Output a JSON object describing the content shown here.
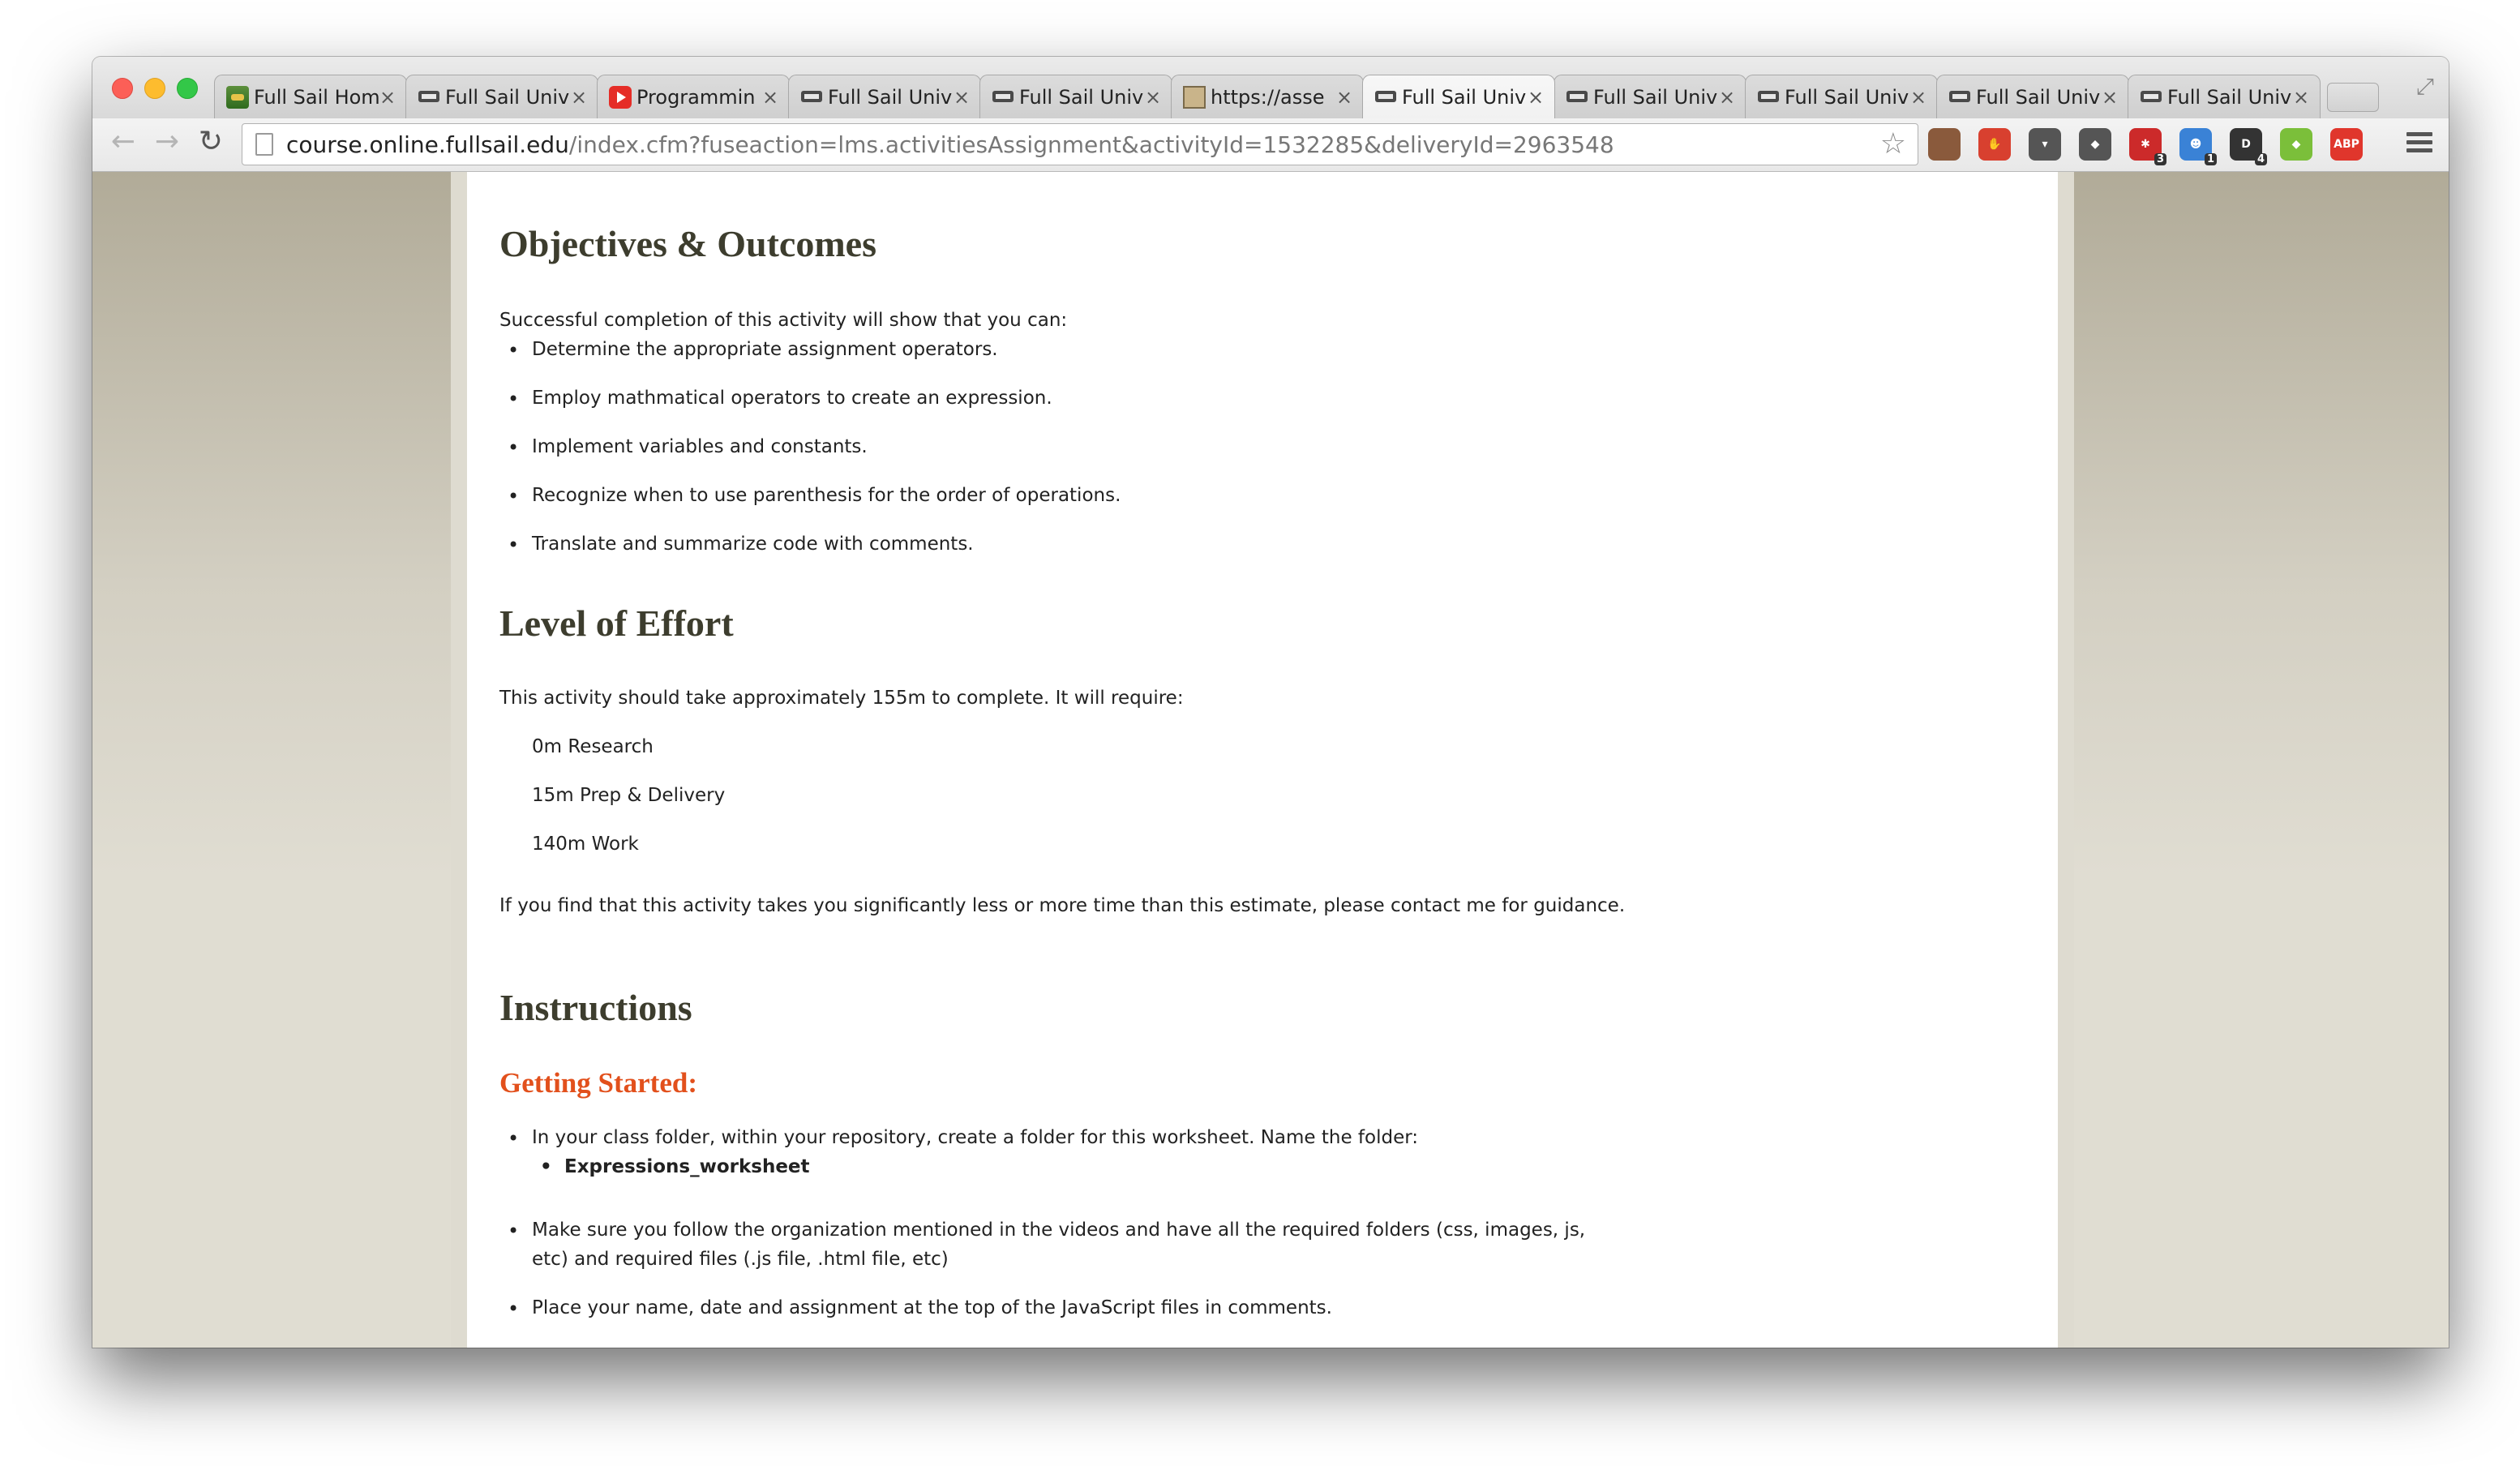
{
  "browser": {
    "tabs": [
      {
        "title": "Full Sail Hom",
        "favicon": "hat-icon",
        "active": false
      },
      {
        "title": "Full Sail Univ",
        "favicon": "fullsail-icon",
        "active": false
      },
      {
        "title": "Programmin",
        "favicon": "youtube-icon",
        "active": false
      },
      {
        "title": "Full Sail Univ",
        "favicon": "fullsail-icon",
        "active": false
      },
      {
        "title": "Full Sail Univ",
        "favicon": "fullsail-icon",
        "active": false
      },
      {
        "title": "https://asse",
        "favicon": "image-icon",
        "active": false
      },
      {
        "title": "Full Sail Univ",
        "favicon": "fullsail-icon",
        "active": true
      },
      {
        "title": "Full Sail Univ",
        "favicon": "fullsail-icon",
        "active": false
      },
      {
        "title": "Full Sail Univ",
        "favicon": "fullsail-icon",
        "active": false
      },
      {
        "title": "Full Sail Univ",
        "favicon": "fullsail-icon",
        "active": false
      },
      {
        "title": "Full Sail Univ",
        "favicon": "fullsail-icon",
        "active": false
      }
    ],
    "tab_close": "×",
    "url_host": "course.online.fullsail.edu",
    "url_path": "/index.cfm?fuseaction=lms.activitiesAssignment&activityId=1532285&deliveryId=2963548",
    "extensions": [
      {
        "name": "instagram-extension-icon",
        "color": "#8a5a3c",
        "label": "",
        "badge": ""
      },
      {
        "name": "stop-hand-extension-icon",
        "color": "#d8402f",
        "label": "✋",
        "badge": ""
      },
      {
        "name": "pocket-extension-icon",
        "color": "#555555",
        "label": "▾",
        "badge": ""
      },
      {
        "name": "tag-extension-icon",
        "color": "#555555",
        "label": "◆",
        "badge": ""
      },
      {
        "name": "puzzle-red-extension-icon",
        "color": "#cc2a2a",
        "label": "✱",
        "badge": "3"
      },
      {
        "name": "ghost-extension-icon",
        "color": "#3a82d6",
        "label": "☻",
        "badge": "1"
      },
      {
        "name": "d-extension-icon",
        "color": "#333333",
        "label": "D",
        "badge": "4"
      },
      {
        "name": "leaf-extension-icon",
        "color": "#7bbf3a",
        "label": "◆",
        "badge": ""
      },
      {
        "name": "adblock-extension-icon",
        "color": "#e0362c",
        "label": "ABP",
        "badge": ""
      }
    ]
  },
  "page": {
    "objectives_heading": "Objectives & Outcomes",
    "objectives_intro": "Successful completion of this activity will show that you can:",
    "objectives": [
      "Determine the appropriate assignment operators.",
      "Employ mathmatical operators to create an expression.",
      "Implement variables and constants.",
      "Recognize when to use parenthesis for the order of operations.",
      "Translate and summarize code with comments."
    ],
    "effort_heading": "Level of Effort",
    "effort_intro": "This activity should take approximately 155m to complete. It will require:",
    "effort_items": [
      "0m Research",
      "15m Prep & Delivery",
      "140m Work"
    ],
    "effort_note": "If you find that this activity takes you significantly less or more time than this estimate, please contact me for guidance.",
    "instructions_heading": "Instructions",
    "getting_started_heading": "Getting Started:",
    "instructions": [
      "In your class folder, within your repository, create a folder for this worksheet. Name the folder:",
      "Make sure you follow the organization mentioned in the videos and have all the required folders (css, images, js,",
      "etc) and required files (.js file, .html file, etc)",
      "Place your name, date and assignment at the top of the JavaScript files in comments."
    ],
    "folder_name": "Expressions_worksheet"
  }
}
